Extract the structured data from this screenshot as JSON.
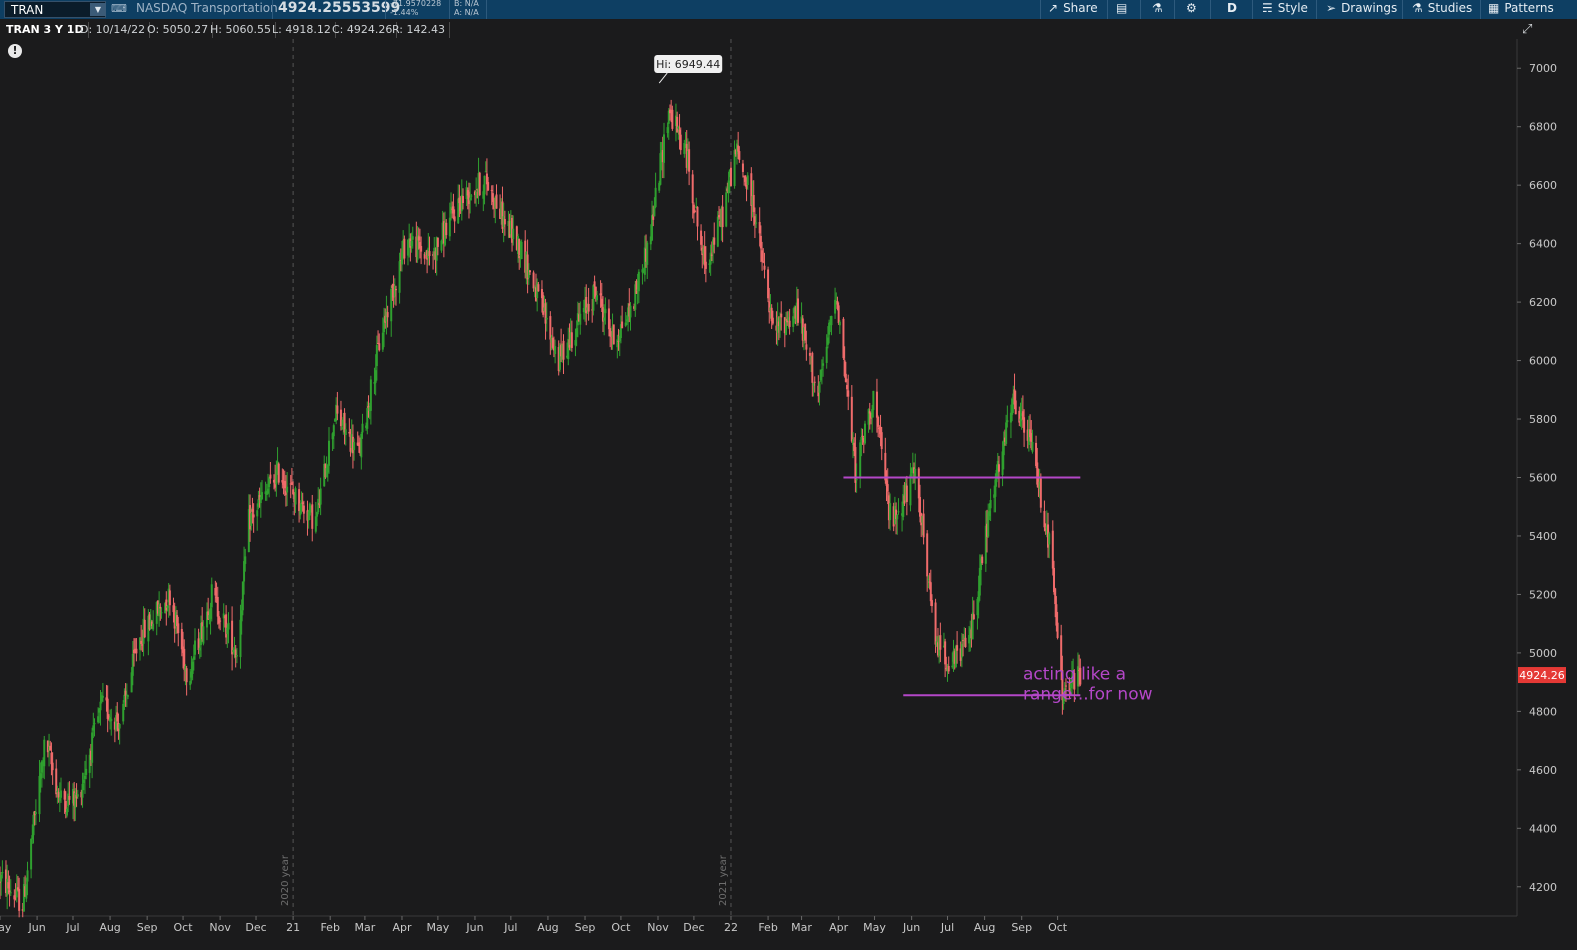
{
  "header": {
    "symbol": "TRAN",
    "symbol_name": "NASDAQ Transportation",
    "last_price": "4924.25553599",
    "change": "-71.9570228",
    "change_pct": "-1.44%",
    "bid": "B: N/A",
    "ask": "A: N/A",
    "share_label": "Share",
    "aggregation": "D",
    "style_label": "Style",
    "drawings_label": "Drawings",
    "studies_label": "Studies",
    "patterns_label": "Patterns"
  },
  "info": {
    "title": "TRAN 3 Y 1D",
    "date": "D: 10/14/22",
    "open": "O: 5050.27",
    "high": "H: 5060.55",
    "low": "L: 4918.12",
    "close": "C: 4924.26",
    "range": "R: 142.43"
  },
  "colors": {
    "up": "#2fa02f",
    "down": "#f06b6b",
    "drawing": "#b447c8",
    "price_tag": "#e53935",
    "background": "#1b1b1c"
  },
  "chart_data": {
    "type": "candlestick",
    "ylim": [
      4100,
      7100
    ],
    "y_ticks": [
      4200,
      4400,
      4600,
      4800,
      5000,
      5200,
      5400,
      5600,
      5800,
      6000,
      6200,
      6400,
      6600,
      6800,
      7000
    ],
    "x_range": [
      "2019-05-01",
      "2022-10-20"
    ],
    "x_ticks": [
      {
        "label": "May",
        "date": "2019-05-01"
      },
      {
        "label": "Jun",
        "date": "2019-06-01"
      },
      {
        "label": "Jul",
        "date": "2019-07-01"
      },
      {
        "label": "Aug",
        "date": "2019-08-01"
      },
      {
        "label": "Sep",
        "date": "2019-09-01"
      },
      {
        "label": "Oct",
        "date": "2019-10-01"
      },
      {
        "label": "Nov",
        "date": "2019-11-01"
      },
      {
        "label": "Dec",
        "date": "2019-12-01"
      },
      {
        "label": "21",
        "date": "2020-01-01"
      },
      {
        "label": "Feb",
        "date": "2020-02-01"
      },
      {
        "label": "Mar",
        "date": "2020-03-01"
      },
      {
        "label": "Apr",
        "date": "2020-04-01"
      },
      {
        "label": "May",
        "date": "2020-05-01"
      },
      {
        "label": "Jun",
        "date": "2020-06-01"
      },
      {
        "label": "Jul",
        "date": "2020-07-01"
      },
      {
        "label": "Aug",
        "date": "2020-08-01"
      },
      {
        "label": "Sep",
        "date": "2020-09-01"
      },
      {
        "label": "Oct",
        "date": "2020-10-01"
      },
      {
        "label": "Nov",
        "date": "2020-11-01"
      },
      {
        "label": "Dec",
        "date": "2020-12-01"
      },
      {
        "label": "22",
        "date": "2021-01-01"
      },
      {
        "label": "Feb",
        "date": "2021-02-01"
      },
      {
        "label": "Mar",
        "date": "2021-03-01"
      },
      {
        "label": "Apr",
        "date": "2021-04-01"
      },
      {
        "label": "May",
        "date": "2021-05-01"
      },
      {
        "label": "Jun",
        "date": "2021-06-01"
      },
      {
        "label": "Jul",
        "date": "2021-07-01"
      },
      {
        "label": "Aug",
        "date": "2021-08-01"
      },
      {
        "label": "Sep",
        "date": "2021-09-01"
      },
      {
        "label": "Oct",
        "date": "2021-10-01"
      }
    ],
    "year_markers": [
      {
        "label": "2020 year",
        "date": "2020-01-01"
      },
      {
        "label": "2021 year",
        "date": "2021-01-01"
      }
    ],
    "price_path": [
      [
        "2019-05-01",
        4230
      ],
      [
        "2019-05-20",
        4140
      ],
      [
        "2019-06-08",
        4700
      ],
      [
        "2019-06-20",
        4500
      ],
      [
        "2019-07-05",
        4500
      ],
      [
        "2019-07-25",
        4820
      ],
      [
        "2019-08-10",
        4760
      ],
      [
        "2019-08-25",
        5050
      ],
      [
        "2019-09-20",
        5200
      ],
      [
        "2019-10-05",
        4920
      ],
      [
        "2019-10-25",
        5200
      ],
      [
        "2019-11-15",
        5000
      ],
      [
        "2019-11-25",
        5450
      ],
      [
        "2019-12-20",
        5620
      ],
      [
        "2020-01-05",
        5520
      ],
      [
        "2020-01-20",
        5450
      ],
      [
        "2020-02-05",
        5820
      ],
      [
        "2020-02-25",
        5680
      ],
      [
        "2020-03-15",
        6100
      ],
      [
        "2020-04-05",
        6420
      ],
      [
        "2020-04-25",
        6350
      ],
      [
        "2020-05-20",
        6550
      ],
      [
        "2020-06-10",
        6620
      ],
      [
        "2020-06-25",
        6480
      ],
      [
        "2020-07-10",
        6380
      ],
      [
        "2020-07-25",
        6200
      ],
      [
        "2020-08-10",
        6000
      ],
      [
        "2020-08-25",
        6120
      ],
      [
        "2020-09-10",
        6240
      ],
      [
        "2020-09-25",
        6070
      ],
      [
        "2020-10-10",
        6180
      ],
      [
        "2020-10-25",
        6420
      ],
      [
        "2020-11-10",
        6860
      ],
      [
        "2020-11-25",
        6700
      ],
      [
        "2020-12-10",
        6320
      ],
      [
        "2020-12-25",
        6500
      ],
      [
        "2021-01-05",
        6720
      ],
      [
        "2021-01-20",
        6530
      ],
      [
        "2021-02-05",
        6100
      ],
      [
        "2021-02-25",
        6170
      ],
      [
        "2021-03-15",
        5880
      ],
      [
        "2021-03-30",
        6240
      ],
      [
        "2021-04-15",
        5620
      ],
      [
        "2021-04-30",
        5880
      ],
      [
        "2021-05-15",
        5440
      ],
      [
        "2021-06-05",
        5620
      ],
      [
        "2021-06-20",
        5050
      ],
      [
        "2021-07-05",
        4960
      ],
      [
        "2021-07-20",
        5060
      ],
      [
        "2021-08-05",
        5480
      ],
      [
        "2021-08-25",
        5860
      ],
      [
        "2021-09-10",
        5700
      ],
      [
        "2021-09-25",
        5350
      ],
      [
        "2021-10-05",
        4860
      ],
      [
        "2021-10-20",
        4924
      ]
    ],
    "high_marker": {
      "label": "Hi: 6949.44",
      "date": "2020-11-02",
      "value": 6949.44
    },
    "last_value": {
      "label": "4924.26",
      "value": 4924.26
    },
    "support_line": {
      "value": 4855,
      "start": "2021-05-25",
      "end": "2021-10-20"
    },
    "resistance_line": {
      "value": 5600,
      "start": "2021-04-05",
      "end": "2021-10-20"
    },
    "annotation": [
      "acting like a",
      "range...for now"
    ]
  }
}
